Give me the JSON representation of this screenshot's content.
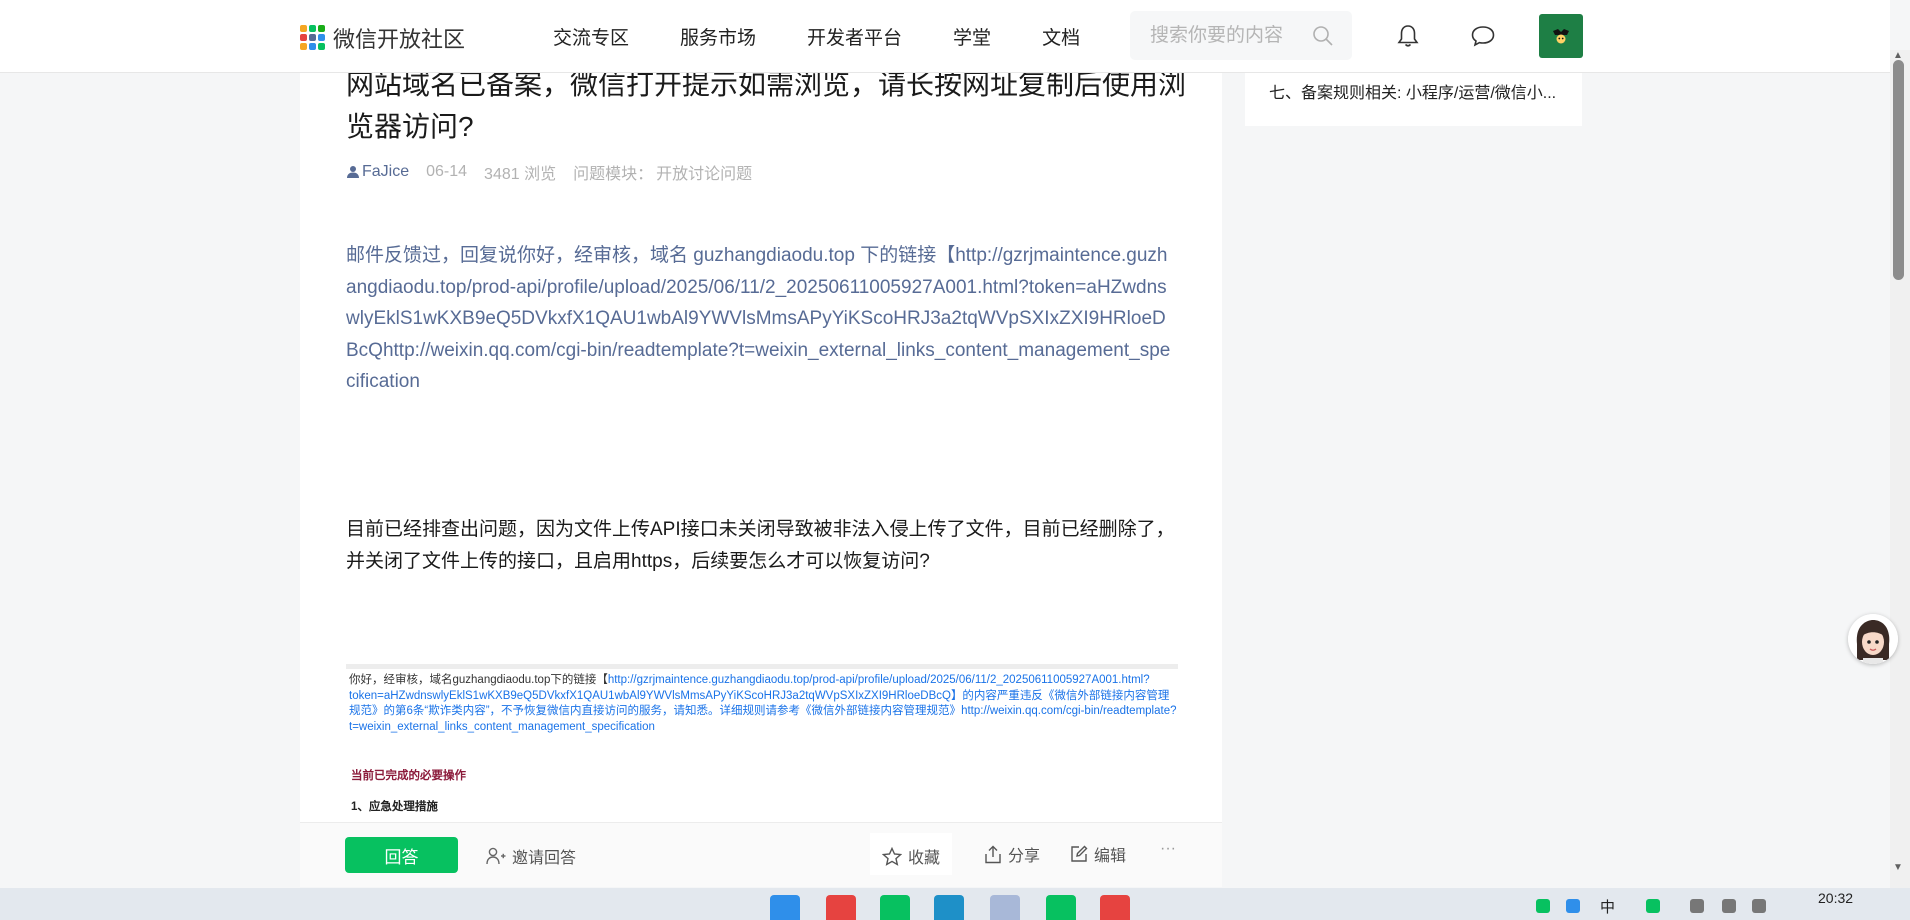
{
  "header": {
    "logo_text": "微信开放社区",
    "nav": [
      "交流专区",
      "服务市场",
      "开发者平台",
      "学堂",
      "文档"
    ],
    "search_placeholder": "搜索你要的内容"
  },
  "post": {
    "title": "网站域名已备案，微信打开提示如需浏览，请长按网址复制后使用浏览器访问?",
    "author": "FaJice",
    "date": "06-14",
    "views": "3481 浏览",
    "module_label": "问题模块：",
    "module_value": "开放讨论问题",
    "link_paragraph": "邮件反馈过，回复说你好，经审核，域名 guzhangdiaodu.top 下的链接【http://gzrjmaintence.guzhangdiaodu.top/prod-api/profile/upload/2025/06/11/2_20250611005927A001.html?token=aHZwdnswlyEklS1wKXB9eQ5DVkxfX1QAU1wbAl9YWVlsMmsAPyYiKScoHRJ3a2tqWVpSXIxZXI9HRloeDBcQhttp://weixin.qq.com/cgi-bin/readtemplate?t=weixin_external_links_content_management_specification",
    "body_paragraph": "目前已经排查出问题，因为文件上传API接口未关闭导致被非法入侵上传了文件，目前已经删除了，并关闭了文件上传的接口，且启用https，后续要怎么才可以恢复访问?",
    "screenshot": {
      "line_intro": "你好，经审核，域名guzhangdiaodu.top下的链接【",
      "line_link": "http://gzrjmaintence.guzhangdiaodu.top/prod-api/profile/upload/2025/06/11/2_20250611005927A001.html?token=aHZwdnswlyEklS1wKXB9eQ5DVkxfX1QAU1wbAl9YWVlsMmsAPyYiKScoHRJ3a2tqWVpSXIxZXI9HRloeDBcQ",
      "line_mid": "】的内容严重违反《微信外部链接内容管理规范》的第6条“欺诈类内容”，不予恢复微信内直接访问的服务，请知悉。详细规则请参考《微信外部链接内容管理规范》",
      "line_url": "http://weixin.qq.com/cgi-bin/readtemplate?t=weixin_external_links_content_management_specification",
      "section_heading": "当前已完成的必要操作",
      "step_1": "1、应急处理措施"
    }
  },
  "actions": {
    "answer": "回答",
    "invite": "邀请回答",
    "favorite": "收藏",
    "share": "分享",
    "edit": "编辑",
    "more": "···"
  },
  "sidebar": {
    "item": "七、备案规则相关: 小程序/运营/微信小..."
  },
  "taskbar": {
    "ime": "中",
    "time": "20:32"
  },
  "colors": {
    "primary_green": "#07c160",
    "link_blue": "#576b95",
    "avatar_green": "#1e7f45"
  }
}
